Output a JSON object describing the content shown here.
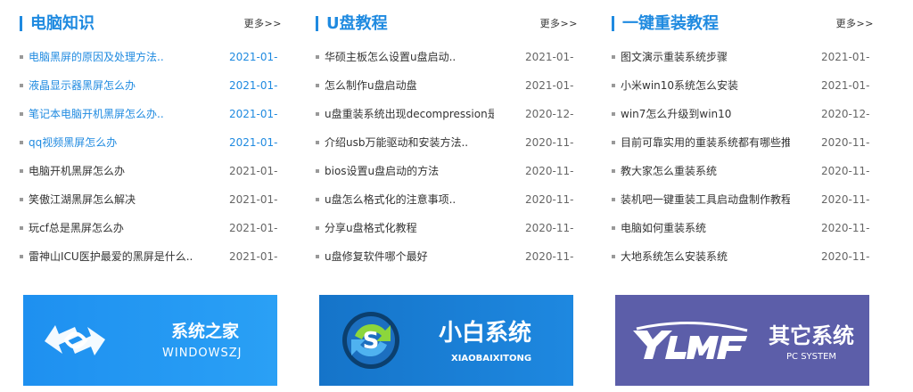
{
  "columns": [
    {
      "title": "电脑知识",
      "more": "更多>>",
      "items": [
        {
          "text": "电脑黑屏的原因及处理方法..",
          "date": "2021-01-",
          "highlight": true
        },
        {
          "text": "液晶显示器黑屏怎么办",
          "date": "2021-01-",
          "highlight": true
        },
        {
          "text": "笔记本电脑开机黑屏怎么办..",
          "date": "2021-01-",
          "highlight": true
        },
        {
          "text": "qq视频黑屏怎么办",
          "date": "2021-01-",
          "highlight": true
        },
        {
          "text": "电脑开机黑屏怎么办",
          "date": "2021-01-",
          "highlight": false
        },
        {
          "text": "笑傲江湖黑屏怎么解决",
          "date": "2021-01-",
          "highlight": false
        },
        {
          "text": "玩cf总是黑屏怎么办",
          "date": "2021-01-",
          "highlight": false
        },
        {
          "text": "雷神山ICU医护最爱的黑屏是什么..",
          "date": "2021-01-",
          "highlight": false
        }
      ],
      "banner": {
        "name": "系统之家",
        "sub": "WINDOWSZJ",
        "icon": "windowszj-logo-icon"
      }
    },
    {
      "title": "U盘教程",
      "more": "更多>>",
      "items": [
        {
          "text": "华硕主板怎么设置u盘启动..",
          "date": "2021-01-",
          "highlight": false
        },
        {
          "text": "怎么制作u盘启动盘",
          "date": "2021-01-",
          "highlight": false
        },
        {
          "text": "u盘重装系统出现decompression是怎..",
          "date": "2020-12-",
          "highlight": false
        },
        {
          "text": "介绍usb万能驱动和安装方法..",
          "date": "2020-11-",
          "highlight": false
        },
        {
          "text": "bios设置u盘启动的方法",
          "date": "2020-11-",
          "highlight": false
        },
        {
          "text": "u盘怎么格式化的注意事项..",
          "date": "2020-11-",
          "highlight": false
        },
        {
          "text": "分享u盘格式化教程",
          "date": "2020-11-",
          "highlight": false
        },
        {
          "text": "u盘修复软件哪个最好",
          "date": "2020-11-",
          "highlight": false
        }
      ],
      "banner": {
        "name": "小白系统",
        "sub": "XIAOBAIXITONG",
        "icon": "xiaobai-logo-icon"
      }
    },
    {
      "title": "一键重装教程",
      "more": "更多>>",
      "items": [
        {
          "text": "图文演示重装系统步骤",
          "date": "2021-01-",
          "highlight": false
        },
        {
          "text": "小米win10系统怎么安装",
          "date": "2021-01-",
          "highlight": false
        },
        {
          "text": "win7怎么升级到win10",
          "date": "2020-12-",
          "highlight": false
        },
        {
          "text": "目前可靠实用的重装系统都有哪些推..",
          "date": "2020-11-",
          "highlight": false
        },
        {
          "text": "教大家怎么重装系统",
          "date": "2020-11-",
          "highlight": false
        },
        {
          "text": "装机吧一键重装工具启动盘制作教程..",
          "date": "2020-11-",
          "highlight": false
        },
        {
          "text": "电脑如何重装系统",
          "date": "2020-11-",
          "highlight": false
        },
        {
          "text": "大地系统怎么安装系统",
          "date": "2020-11-",
          "highlight": false
        }
      ],
      "banner": {
        "name": "其它系统",
        "sub": "PC SYSTEM",
        "icon": "ylmf-logo-icon"
      }
    }
  ],
  "colors": {
    "accent": "#1f8ae0",
    "text": "#333333",
    "date": "#666666",
    "banner3": "#5c5ea9"
  }
}
